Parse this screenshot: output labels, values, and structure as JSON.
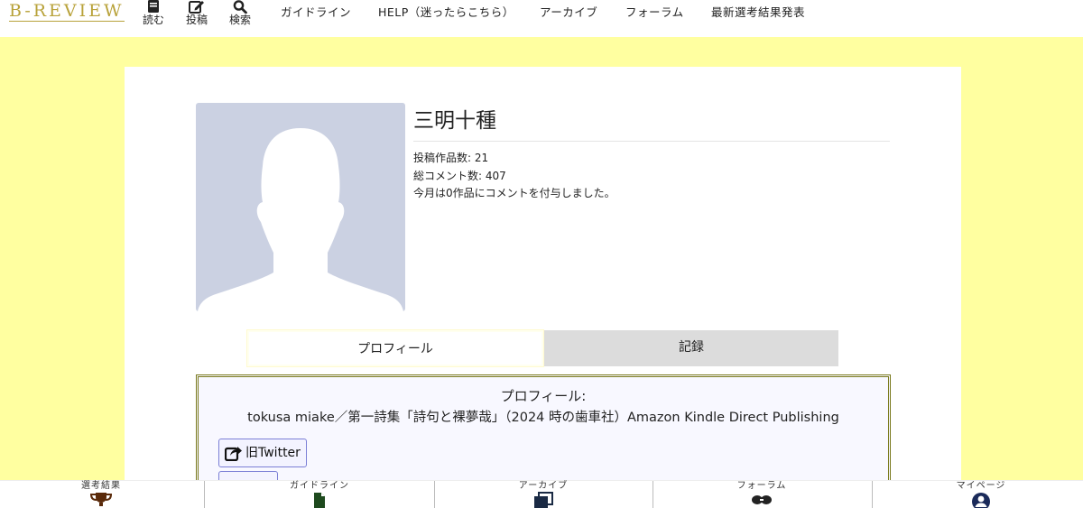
{
  "header": {
    "logo": "B-REVIEW",
    "icons": [
      {
        "label": "読む",
        "icon": "book-icon"
      },
      {
        "label": "投稿",
        "icon": "edit-icon"
      },
      {
        "label": "検索",
        "icon": "search-icon"
      }
    ],
    "links": [
      "ガイドライン",
      "HELP（迷ったらこちら）",
      "アーカイブ",
      "フォーラム",
      "最新選考結果発表"
    ]
  },
  "profile": {
    "name": "三明十種",
    "stats": [
      "投稿作品数: 21",
      "総コメント数: 407",
      "今月は0作品にコメントを付与しました。"
    ]
  },
  "tabs": [
    "プロフィール",
    "記録"
  ],
  "profile_box": {
    "label": "プロフィール:",
    "text": "tokusa miake／第一詩集「詩句と裸夢哉」（2024 時の歯車社）Amazon Kindle Direct Publishing",
    "share_button": "旧Twitter"
  },
  "bottom_nav": [
    {
      "label": "選考結果",
      "icon": "trophy-icon"
    },
    {
      "label": "ガイドライン",
      "icon": "file-icon"
    },
    {
      "label": "アーカイブ",
      "icon": "archive-icon"
    },
    {
      "label": "フォーラム",
      "icon": "forum-icon"
    },
    {
      "label": "マイページ",
      "icon": "user-icon"
    }
  ],
  "colors": {
    "background": "#ffffa0",
    "logo": "#b8a23a",
    "avatar": "#cbd1e2",
    "profile_border": "#7a7a1e"
  }
}
